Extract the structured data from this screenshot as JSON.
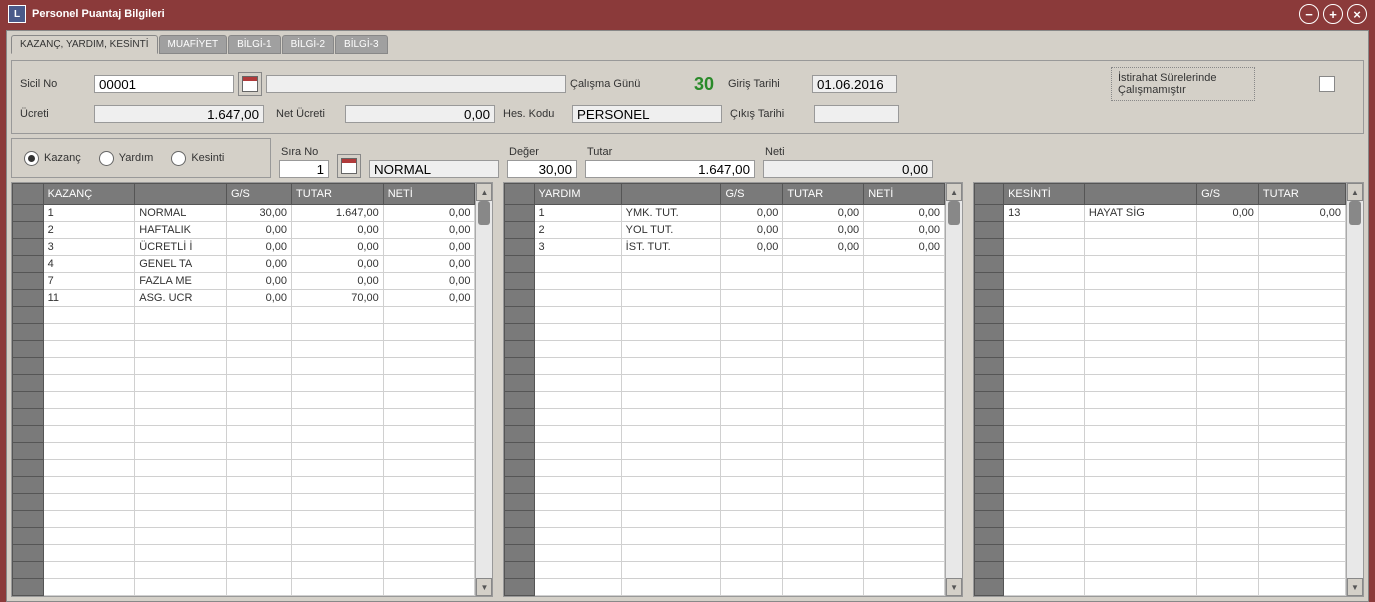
{
  "title": "Personel Puantaj Bilgileri",
  "tabs": [
    "KAZANÇ, YARDIM, KESİNTİ",
    "MUAFİYET",
    "BİLGİ-1",
    "BİLGİ-2",
    "BİLGİ-3"
  ],
  "form": {
    "sicil_no_lbl": "Sicil No",
    "sicil_no": "00001",
    "calisma_gunu_lbl": "Çalışma Günü",
    "calisma_gunu": "30",
    "giris_tarihi_lbl": "Giriş Tarihi",
    "giris_tarihi": "01.06.2016",
    "istirahat_lbl": "İstirahat Sürelerinde Çalışmamıştır",
    "ucreti_lbl": "Ücreti",
    "ucreti": "1.647,00",
    "net_ucreti_lbl": "Net Ücreti",
    "net_ucreti": "0,00",
    "hes_kodu_lbl": "Hes. Kodu",
    "hes_kodu": "PERSONEL",
    "cikis_tarihi_lbl": "Çıkış Tarihi",
    "cikis_tarihi": "",
    "sira_no_lbl": "Sıra No",
    "sira_no": "1",
    "sira_ad": "NORMAL",
    "deger_lbl": "Değer",
    "deger": "30,00",
    "tutar_lbl": "Tutar",
    "tutar": "1.647,00",
    "neti_lbl": "Neti",
    "neti": "0,00"
  },
  "radio": {
    "kazanc": "Kazanç",
    "yardim": "Yardım",
    "kesinti": "Kesinti"
  },
  "grid1": {
    "headers": [
      "",
      "KAZANÇ",
      "",
      "G/S",
      "TUTAR",
      "NETİ"
    ],
    "rows": [
      [
        "1",
        "NORMAL",
        "30,00",
        "1.647,00",
        "0,00"
      ],
      [
        "2",
        "HAFTALIK",
        "0,00",
        "0,00",
        "0,00"
      ],
      [
        "3",
        "ÜCRETLİ İ",
        "0,00",
        "0,00",
        "0,00"
      ],
      [
        "4",
        "GENEL TA",
        "0,00",
        "0,00",
        "0,00"
      ],
      [
        "7",
        "FAZLA ME",
        "0,00",
        "0,00",
        "0,00"
      ],
      [
        "11",
        "ASG. UCR",
        "0,00",
        "70,00",
        "0,00"
      ]
    ]
  },
  "grid2": {
    "headers": [
      "",
      "YARDIM",
      "",
      "G/S",
      "TUTAR",
      "NETİ"
    ],
    "rows": [
      [
        "1",
        "YMK. TUT.",
        "0,00",
        "0,00",
        "0,00"
      ],
      [
        "2",
        "YOL TUT.",
        "0,00",
        "0,00",
        "0,00"
      ],
      [
        "3",
        "İST. TUT.",
        "0,00",
        "0,00",
        "0,00"
      ]
    ]
  },
  "grid3": {
    "headers": [
      "",
      "KESİNTİ",
      "",
      "G/S",
      "TUTAR"
    ],
    "rows": [
      [
        "13",
        "HAYAT SİG",
        "0,00",
        "0,00"
      ]
    ]
  }
}
